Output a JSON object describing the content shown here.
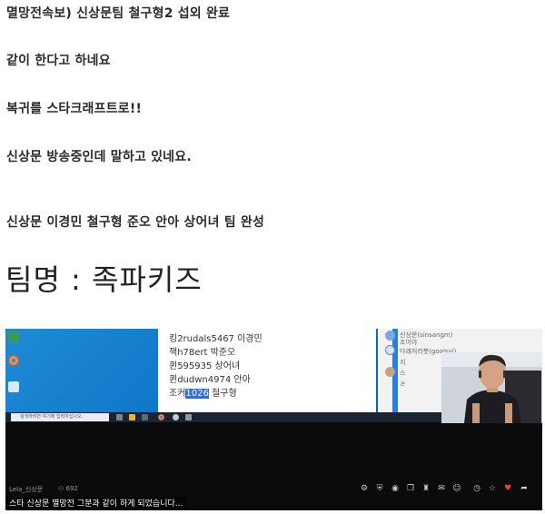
{
  "post": {
    "lines": [
      "멸망전속보) 신상문팀 철구형2 섭외 완료",
      "같이 한다고 하네요",
      "복귀를 스타크래프트로!!",
      "신상문 방송중인데 말하고 있네요.",
      "신상문 이경민 철구형 준오 안아 상어녀 팀 완성"
    ],
    "team_name": "팀명 : 족파키즈"
  },
  "screenshot": {
    "memo_lines": [
      {
        "prefix": "",
        "text": "킹2rudals5467 이경민"
      },
      {
        "prefix": "",
        "text": "잭h78ert 박준오"
      },
      {
        "prefix": "",
        "text": "퀸595935 상어녀"
      },
      {
        "prefix": "",
        "text": "퀸dudwn4974 안아"
      },
      {
        "prefix": "조커",
        "selected": "1026",
        "suffix": " 철구형"
      }
    ],
    "taskbar_search_placeholder": "검색하려면 여기에 입력하십시오.",
    "chat_lines": [
      "신상문(sinsangm)",
      "조이야",
      "다래처리봇(goalsvi)",
      "지",
      "스",
      "ㄹ"
    ],
    "streamer_name": "Lela_신상문",
    "viewer_count": "692",
    "subtitle": "스타 신상문 멸망전 그분과 같이 하게 되었습니다...",
    "icons": {
      "viewers": "people-icon",
      "controls": [
        "settings-icon",
        "shield-icon",
        "mic-icon",
        "copy-icon",
        "cup-icon",
        "chat-icon",
        "emoji-icon",
        "clock-icon",
        "star-icon",
        "heart-icon",
        "share-icon"
      ]
    },
    "colors": {
      "desktop_blue": "#0e76c8",
      "selection": "#2f6fd0",
      "heart": "#e0463f"
    }
  }
}
